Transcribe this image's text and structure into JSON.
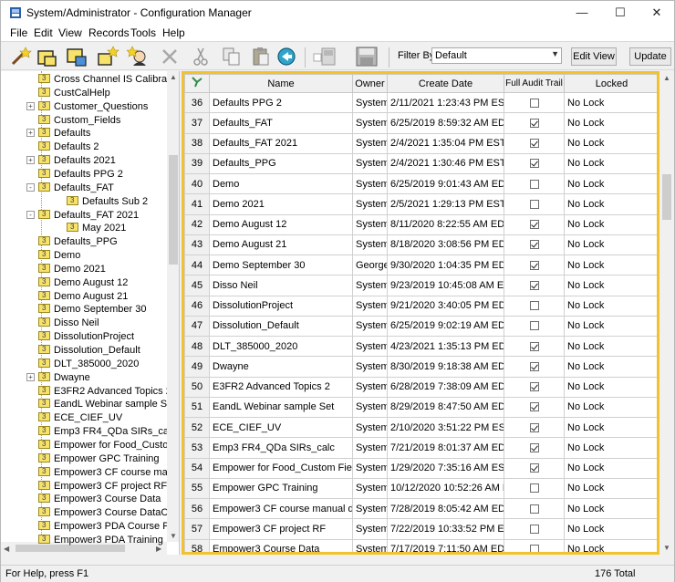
{
  "window": {
    "title": "System/Administrator - Configuration Manager"
  },
  "menu": [
    "File",
    "Edit",
    "View",
    "Records",
    "Tools",
    "Help"
  ],
  "toolbar": {
    "filter_label": "Filter By:",
    "filter_value": "Default",
    "edit_view_label": "Edit View",
    "update_label": "Update"
  },
  "tree": {
    "items": [
      {
        "label": "Cross Channel IS Calibrat",
        "indent": 1,
        "expander": ""
      },
      {
        "label": "CustCalHelp",
        "indent": 1,
        "expander": ""
      },
      {
        "label": "Customer_Questions",
        "indent": 1,
        "expander": "+"
      },
      {
        "label": "Custom_Fields",
        "indent": 1,
        "expander": ""
      },
      {
        "label": "Defaults",
        "indent": 1,
        "expander": "+"
      },
      {
        "label": "Defaults 2",
        "indent": 1,
        "expander": ""
      },
      {
        "label": "Defaults 2021",
        "indent": 1,
        "expander": "+"
      },
      {
        "label": "Defaults PPG 2",
        "indent": 1,
        "expander": ""
      },
      {
        "label": "Defaults_FAT",
        "indent": 1,
        "expander": "-"
      },
      {
        "label": "Defaults Sub 2",
        "indent": 2,
        "expander": ""
      },
      {
        "label": "Defaults_FAT 2021",
        "indent": 1,
        "expander": "-"
      },
      {
        "label": "May 2021",
        "indent": 2,
        "expander": ""
      },
      {
        "label": "Defaults_PPG",
        "indent": 1,
        "expander": ""
      },
      {
        "label": "Demo",
        "indent": 1,
        "expander": ""
      },
      {
        "label": "Demo 2021",
        "indent": 1,
        "expander": ""
      },
      {
        "label": "Demo August 12",
        "indent": 1,
        "expander": ""
      },
      {
        "label": "Demo August 21",
        "indent": 1,
        "expander": ""
      },
      {
        "label": "Demo September 30",
        "indent": 1,
        "expander": ""
      },
      {
        "label": "Disso Neil",
        "indent": 1,
        "expander": ""
      },
      {
        "label": "DissolutionProject",
        "indent": 1,
        "expander": ""
      },
      {
        "label": "Dissolution_Default",
        "indent": 1,
        "expander": ""
      },
      {
        "label": "DLT_385000_2020",
        "indent": 1,
        "expander": ""
      },
      {
        "label": "Dwayne",
        "indent": 1,
        "expander": "+"
      },
      {
        "label": "E3FR2 Advanced Topics 2",
        "indent": 1,
        "expander": ""
      },
      {
        "label": "EandL Webinar sample Se",
        "indent": 1,
        "expander": ""
      },
      {
        "label": "ECE_CIEF_UV",
        "indent": 1,
        "expander": ""
      },
      {
        "label": "Emp3 FR4_QDa SIRs_calc",
        "indent": 1,
        "expander": ""
      },
      {
        "label": "Empower for Food_Custo",
        "indent": 1,
        "expander": ""
      },
      {
        "label": "Empower GPC Training",
        "indent": 1,
        "expander": ""
      },
      {
        "label": "Empower3 CF course ma",
        "indent": 1,
        "expander": ""
      },
      {
        "label": "Empower3 CF project RF",
        "indent": 1,
        "expander": ""
      },
      {
        "label": "Empower3 Course Data",
        "indent": 1,
        "expander": ""
      },
      {
        "label": "Empower3 Course DataC",
        "indent": 1,
        "expander": ""
      },
      {
        "label": "Empower3 PDA Course P",
        "indent": 1,
        "expander": ""
      },
      {
        "label": "Empower3 PDA Training",
        "indent": 1,
        "expander": ""
      }
    ]
  },
  "grid": {
    "columns": [
      "Name",
      "Owner",
      "Create Date",
      "Full Audit Trail",
      "Locked"
    ],
    "rows": [
      {
        "n": "36",
        "name": "Defaults PPG 2",
        "owner": "System",
        "date": "2/11/2021 1:23:43 PM EST",
        "audit": false,
        "locked": "No Lock"
      },
      {
        "n": "37",
        "name": "Defaults_FAT",
        "owner": "System",
        "date": "6/25/2019 8:59:32 AM EDT",
        "audit": true,
        "locked": "No Lock"
      },
      {
        "n": "38",
        "name": "Defaults_FAT 2021",
        "owner": "System",
        "date": "2/4/2021 1:35:04 PM EST",
        "audit": true,
        "locked": "No Lock"
      },
      {
        "n": "39",
        "name": "Defaults_PPG",
        "owner": "System",
        "date": "2/4/2021 1:30:46 PM EST",
        "audit": true,
        "locked": "No Lock"
      },
      {
        "n": "40",
        "name": "Demo",
        "owner": "System",
        "date": "6/25/2019 9:01:43 AM EDT",
        "audit": false,
        "locked": "No Lock"
      },
      {
        "n": "41",
        "name": "Demo 2021",
        "owner": "System",
        "date": "2/5/2021 1:29:13 PM EST",
        "audit": false,
        "locked": "No Lock"
      },
      {
        "n": "42",
        "name": "Demo August 12",
        "owner": "System",
        "date": "8/11/2020 8:22:55 AM EDT",
        "audit": true,
        "locked": "No Lock"
      },
      {
        "n": "43",
        "name": "Demo August 21",
        "owner": "System",
        "date": "8/18/2020 3:08:56 PM EDT",
        "audit": true,
        "locked": "No Lock"
      },
      {
        "n": "44",
        "name": "Demo September 30",
        "owner": "George",
        "date": "9/30/2020 1:04:35 PM EDT",
        "audit": true,
        "locked": "No Lock"
      },
      {
        "n": "45",
        "name": "Disso Neil",
        "owner": "System",
        "date": "9/23/2019 10:45:08 AM EDT",
        "audit": true,
        "locked": "No Lock"
      },
      {
        "n": "46",
        "name": "DissolutionProject",
        "owner": "System",
        "date": "9/21/2020 3:40:05 PM EDT",
        "audit": false,
        "locked": "No Lock"
      },
      {
        "n": "47",
        "name": "Dissolution_Default",
        "owner": "System",
        "date": "6/25/2019 9:02:19 AM EDT",
        "audit": false,
        "locked": "No Lock"
      },
      {
        "n": "48",
        "name": "DLT_385000_2020",
        "owner": "System",
        "date": "4/23/2021 1:35:13 PM EDT",
        "audit": true,
        "locked": "No Lock"
      },
      {
        "n": "49",
        "name": "Dwayne",
        "owner": "System",
        "date": "8/30/2019 9:18:38 AM EDT",
        "audit": true,
        "locked": "No Lock"
      },
      {
        "n": "50",
        "name": "E3FR2 Advanced Topics 2",
        "owner": "System",
        "date": "6/28/2019 7:38:09 AM EDT",
        "audit": true,
        "locked": "No Lock"
      },
      {
        "n": "51",
        "name": "EandL Webinar sample Set",
        "owner": "System",
        "date": "8/29/2019 8:47:50 AM EDT",
        "audit": true,
        "locked": "No Lock"
      },
      {
        "n": "52",
        "name": "ECE_CIEF_UV",
        "owner": "System",
        "date": "2/10/2020 3:51:22 PM EST",
        "audit": true,
        "locked": "No Lock"
      },
      {
        "n": "53",
        "name": "Emp3 FR4_QDa SIRs_calc",
        "owner": "System",
        "date": "7/21/2019 8:01:37 AM EDT",
        "audit": true,
        "locked": "No Lock"
      },
      {
        "n": "54",
        "name": "Empower for Food_Custom Fields",
        "owner": "System",
        "date": "1/29/2020 7:35:16 AM EST",
        "audit": true,
        "locked": "No Lock"
      },
      {
        "n": "55",
        "name": "Empower GPC Training",
        "owner": "System",
        "date": "10/12/2020 10:52:26 AM EDT",
        "audit": false,
        "locked": "No Lock"
      },
      {
        "n": "56",
        "name": "Empower3 CF course manual data",
        "owner": "System",
        "date": "7/28/2019 8:05:42 AM EDT",
        "audit": false,
        "locked": "No Lock"
      },
      {
        "n": "57",
        "name": "Empower3 CF project RF",
        "owner": "System",
        "date": "7/22/2019 10:33:52 PM EDT",
        "audit": false,
        "locked": "No Lock"
      },
      {
        "n": "58",
        "name": "Empower3 Course Data",
        "owner": "System",
        "date": "7/17/2019 7:11:50 AM EDT",
        "audit": false,
        "locked": "No Lock"
      }
    ]
  },
  "status": {
    "left": "For Help, press F1",
    "right": "176 Total"
  },
  "colors": {
    "highlight_border": "#f2c12e",
    "folder": "#f7e26b"
  },
  "icons": [
    "app-icon",
    "minimize-icon",
    "maximize-icon",
    "close-icon",
    "wand-icon",
    "folder-new-icon",
    "folder-open-icon",
    "star-icon",
    "user-icon",
    "delete-x-icon",
    "cut-icon",
    "copy-icon",
    "paste-icon",
    "back-icon",
    "window-icon",
    "save-icon",
    "grid-logo-icon"
  ]
}
